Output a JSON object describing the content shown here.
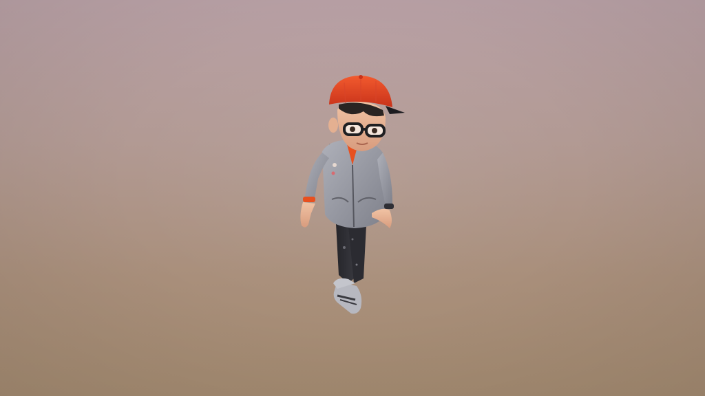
{
  "scene": {
    "subject": "3d-cartoon-character",
    "background_top_color": "#b9a1a6",
    "background_bottom_color": "#a38a70",
    "cap_color": "#e8401f",
    "jacket_color": "#9a9ca6",
    "pants_color": "#2c2c30",
    "shirt_color": "#e8501f"
  }
}
